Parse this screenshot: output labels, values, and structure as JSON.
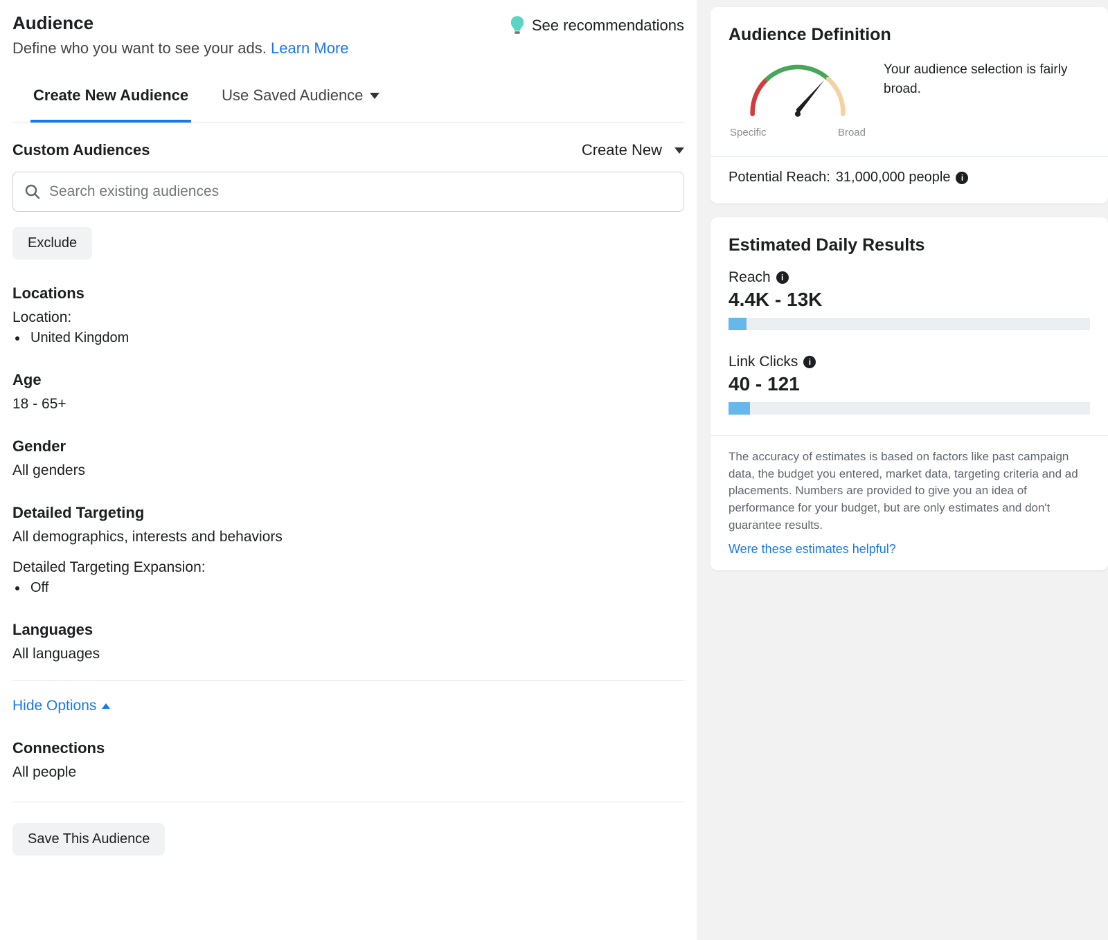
{
  "header": {
    "title": "Audience",
    "subtitle_lead": "Define who you want to see your ads. ",
    "learn_more": "Learn More",
    "see_recommendations": "See recommendations"
  },
  "tabs": {
    "create": "Create New Audience",
    "saved": "Use Saved Audience"
  },
  "custom_audiences": {
    "label": "Custom Audiences",
    "create_new": "Create New",
    "search_placeholder": "Search existing audiences",
    "exclude": "Exclude"
  },
  "locations": {
    "label": "Locations",
    "sublabel": "Location:",
    "items": [
      "United Kingdom"
    ]
  },
  "age": {
    "label": "Age",
    "value": "18 - 65+"
  },
  "gender": {
    "label": "Gender",
    "value": "All genders"
  },
  "detailed": {
    "label": "Detailed Targeting",
    "value": "All demographics, interests and behaviors",
    "expansion_label": "Detailed Targeting Expansion:",
    "expansion_items": [
      "Off"
    ]
  },
  "languages": {
    "label": "Languages",
    "value": "All languages"
  },
  "options_toggle": "Hide Options",
  "connections": {
    "label": "Connections",
    "value": "All people"
  },
  "save_button": "Save This Audience",
  "audience_definition": {
    "title": "Audience Definition",
    "pointer_specific": "Specific",
    "pointer_broad": "Broad",
    "description": "Your audience selection is fairly broad.",
    "reach_label": "Potential Reach:",
    "reach_value": "31,000,000 people"
  },
  "daily_results": {
    "title": "Estimated Daily Results",
    "reach": {
      "label": "Reach",
      "value": "4.4K - 13K",
      "pct": 5
    },
    "clicks": {
      "label": "Link Clicks",
      "value": "40 - 121",
      "pct": 6
    },
    "disclaimer": "The accuracy of estimates is based on factors like past campaign data, the budget you entered, market data, targeting criteria and ad placements. Numbers are provided to give you an idea of performance for your budget, but are only estimates and don't guarantee results.",
    "feedback_link": "Were these estimates helpful?"
  }
}
